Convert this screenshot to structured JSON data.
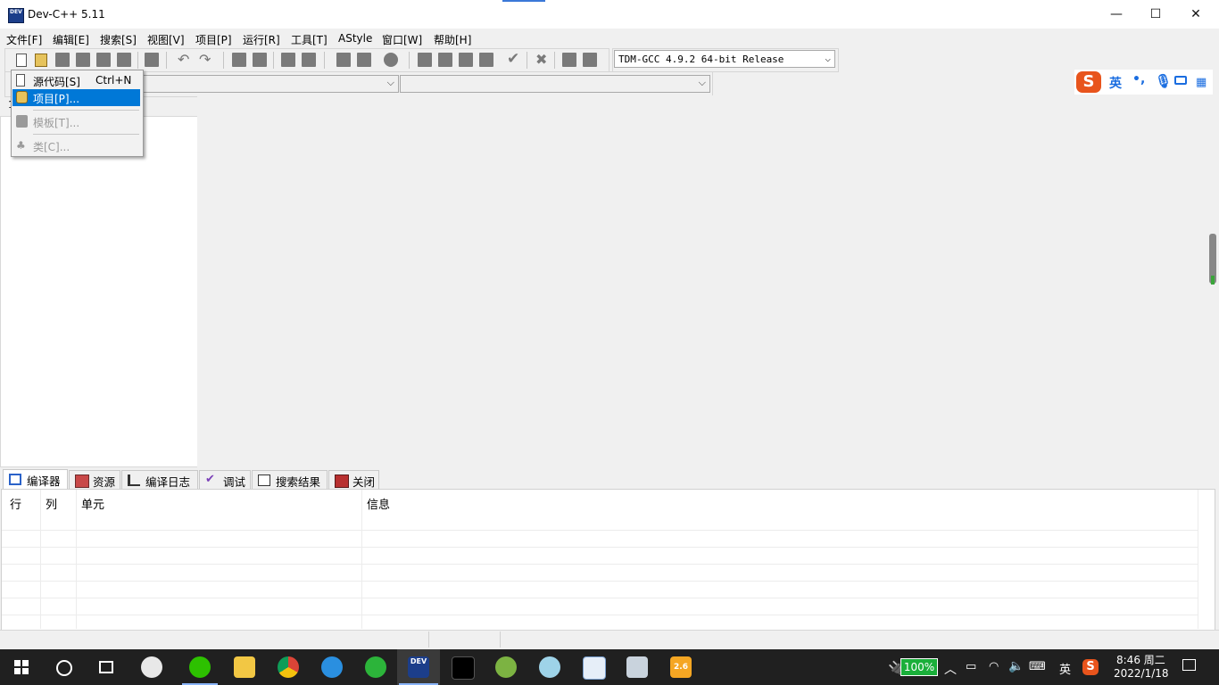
{
  "window": {
    "title": "Dev-C++ 5.11",
    "app_icon_text": "DEV",
    "minimize": "—",
    "maximize": "☐",
    "close": "✕"
  },
  "menu": {
    "items": [
      "文件[F]",
      "编辑[E]",
      "搜索[S]",
      "视图[V]",
      "项目[P]",
      "运行[R]",
      "工具[T]",
      "AStyle",
      "窗口[W]",
      "帮助[H]"
    ]
  },
  "toolbar": {
    "compiler": "TDM-GCC 4.9.2 64-bit Release"
  },
  "new_menu": {
    "items": [
      {
        "label": "源代码[S]",
        "shortcut": "Ctrl+N",
        "icon": "file-icon",
        "state": "normal"
      },
      {
        "label": "项目[P]...",
        "shortcut": "",
        "icon": "project-icon",
        "state": "highlighted"
      },
      {
        "label": "模板[T]...",
        "shortcut": "",
        "icon": "template-icon",
        "state": "disabled"
      },
      {
        "label": "类[C]...",
        "shortcut": "",
        "icon": "class-icon",
        "state": "disabled"
      }
    ]
  },
  "left_panel": {
    "label": "1"
  },
  "ime": {
    "lang": "英",
    "punct": "•,",
    "icons": [
      "sogou-logo-icon",
      "mic-icon",
      "keyboard-icon",
      "apps-grid-icon"
    ]
  },
  "bottom_tabs": [
    "编译器",
    "资源",
    "编译日志",
    "调试",
    "搜索结果",
    "关闭"
  ],
  "messages": {
    "columns": [
      "行",
      "列",
      "单元",
      "信息"
    ]
  },
  "taskbar": {
    "battery": "100%",
    "ime_lang": "英",
    "time": "8:46 周二",
    "date": "2022/1/18",
    "app_badge": "2.6"
  },
  "colors": {
    "highlight": "#0078d7",
    "taskbar": "#202020",
    "sogou": "#e8541c"
  }
}
